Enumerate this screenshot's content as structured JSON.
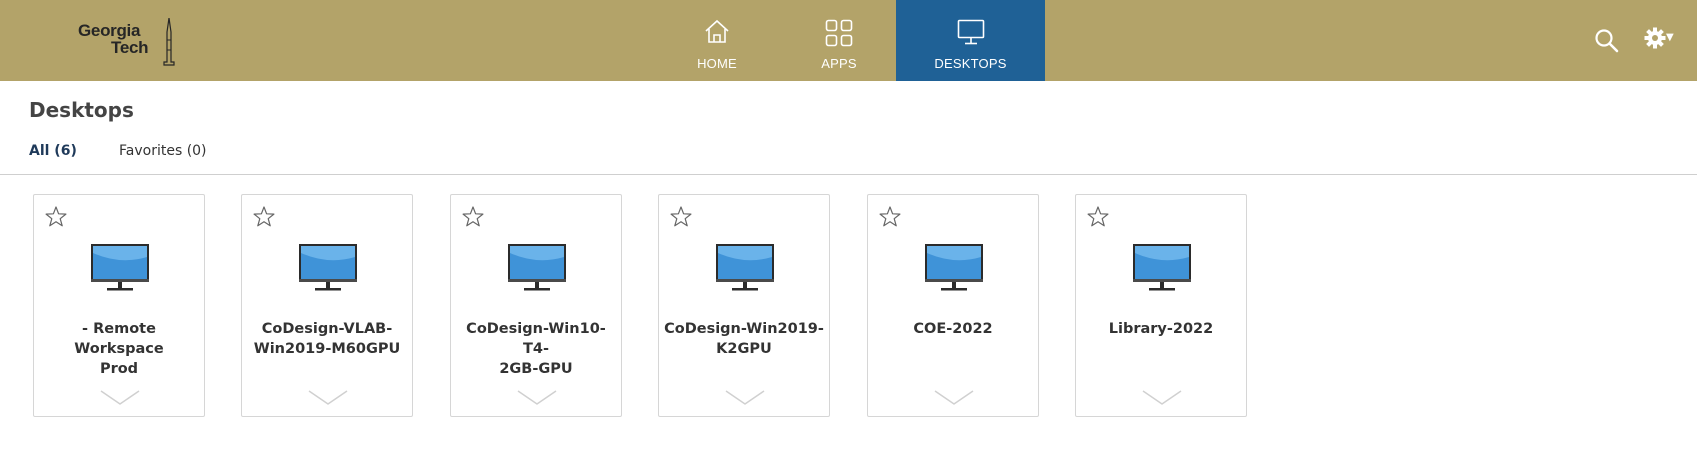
{
  "header": {
    "logo": {
      "line1": "Georgia",
      "line2": "Tech"
    },
    "nav": [
      {
        "label": "HOME",
        "icon": "home-icon"
      },
      {
        "label": "APPS",
        "icon": "apps-grid-icon"
      },
      {
        "label": "DESKTOPS",
        "icon": "monitor-icon",
        "active": true
      }
    ],
    "actions": [
      "search-icon",
      "gear-icon"
    ]
  },
  "main": {
    "title": "Desktops",
    "filters": [
      {
        "label": "All (6)",
        "active": true
      },
      {
        "label": "Favorites (0)"
      }
    ],
    "desktops": [
      {
        "name_line1": "- Remote Workspace",
        "name_line2": "Prod"
      },
      {
        "name_line1": "CoDesign-VLAB-",
        "name_line2": "Win2019-M60GPU"
      },
      {
        "name_line1": "CoDesign-Win10-T4-",
        "name_line2": "2GB-GPU"
      },
      {
        "name_line1": "CoDesign-Win2019-",
        "name_line2": "K2GPU"
      },
      {
        "name_line1": "COE-2022",
        "name_line2": ""
      },
      {
        "name_line1": "Library-2022",
        "name_line2": ""
      }
    ]
  },
  "colors": {
    "header_bg": "#b3a369",
    "active_tab": "#1f6196",
    "monitor_screen": "#3f93d8"
  }
}
